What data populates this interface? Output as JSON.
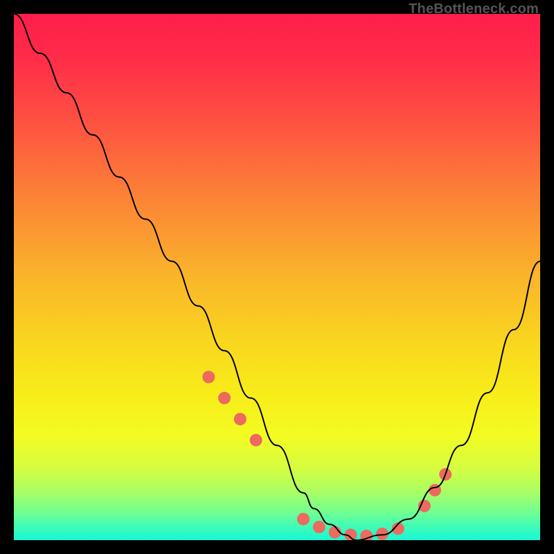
{
  "watermark": "TheBottleneck.com",
  "chart_data": {
    "type": "line",
    "title": "",
    "xlabel": "",
    "ylabel": "",
    "xlim": [
      0,
      100
    ],
    "ylim": [
      0,
      100
    ],
    "grid": false,
    "legend": false,
    "series": [
      {
        "name": "curve",
        "color": "#000000",
        "x": [
          0,
          5,
          10,
          15,
          20,
          25,
          30,
          35,
          40,
          45,
          50,
          55,
          57,
          60,
          63,
          65,
          70,
          75,
          80,
          85,
          90,
          95,
          100
        ],
        "y": [
          100,
          92.5,
          85,
          77,
          69,
          61,
          53,
          44.5,
          36,
          27,
          18,
          9,
          6,
          3,
          1,
          0,
          1,
          4,
          10,
          18,
          28,
          40,
          53
        ]
      }
    ],
    "markers": {
      "name": "dots",
      "color": "#EC6A5E",
      "radius": 9,
      "x": [
        37,
        40,
        43,
        46,
        55,
        58,
        61,
        64,
        67,
        70,
        73,
        78,
        80,
        82
      ],
      "y": [
        31,
        27,
        23,
        19,
        4,
        2.5,
        1.5,
        1,
        0.8,
        1.2,
        2.2,
        6.5,
        9.5,
        12.5
      ]
    },
    "background_gradient_stops": [
      {
        "offset": 0.0,
        "color": "#FF1E4B"
      },
      {
        "offset": 0.08,
        "color": "#FF2B49"
      },
      {
        "offset": 0.2,
        "color": "#FE5042"
      },
      {
        "offset": 0.35,
        "color": "#FC8336"
      },
      {
        "offset": 0.5,
        "color": "#FAB52A"
      },
      {
        "offset": 0.62,
        "color": "#F9D51F"
      },
      {
        "offset": 0.72,
        "color": "#F8EC19"
      },
      {
        "offset": 0.8,
        "color": "#F3FB22"
      },
      {
        "offset": 0.86,
        "color": "#D7FD3E"
      },
      {
        "offset": 0.91,
        "color": "#A8FE66"
      },
      {
        "offset": 0.95,
        "color": "#6CFE95"
      },
      {
        "offset": 0.975,
        "color": "#3DFCB8"
      },
      {
        "offset": 1.0,
        "color": "#18F7D4"
      }
    ]
  }
}
